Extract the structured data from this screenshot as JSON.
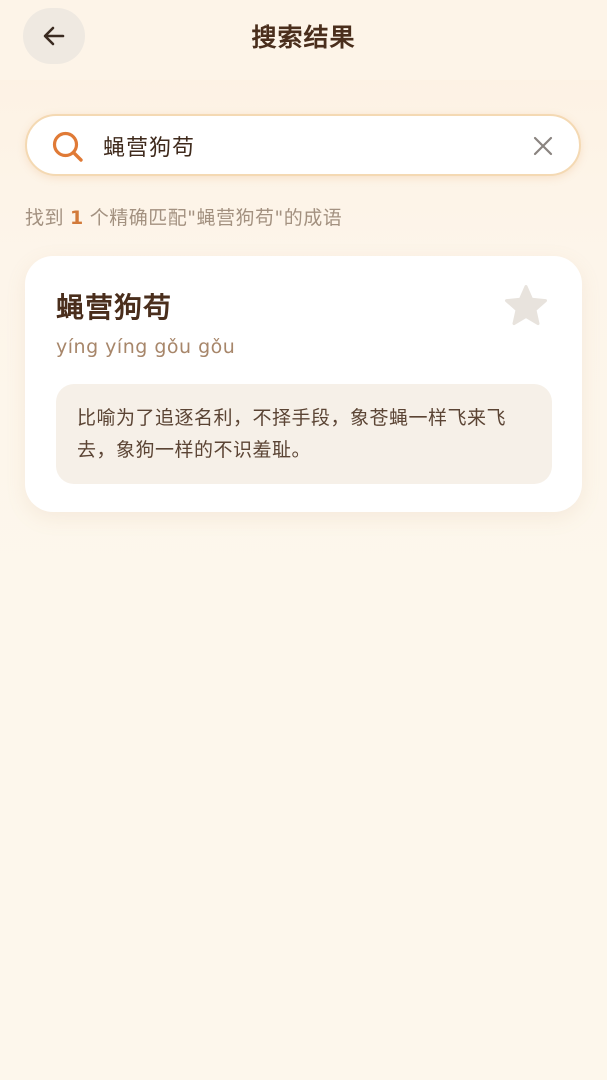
{
  "header": {
    "title": "搜索结果"
  },
  "search": {
    "query": "蝇营狗苟"
  },
  "result_info": {
    "prefix": "找到",
    "count": "1",
    "suffix": "个精确匹配\"蝇营狗苟\"的成语"
  },
  "results": [
    {
      "idiom": "蝇营狗苟",
      "pinyin": "yíng yíng gǒu gǒu",
      "definition": "比喻为了追逐名利，不择手段，象苍蝇一样飞来飞去，象狗一样的不识羞耻。",
      "favorited": false
    }
  ],
  "icons": {
    "back": "arrow-left-icon",
    "search": "search-icon",
    "clear": "close-icon",
    "favorite": "star-icon"
  },
  "colors": {
    "accent": "#e07a36",
    "title": "#4a2e1c",
    "background": "#fdf7ec",
    "star_inactive": "#e8e3dd"
  }
}
